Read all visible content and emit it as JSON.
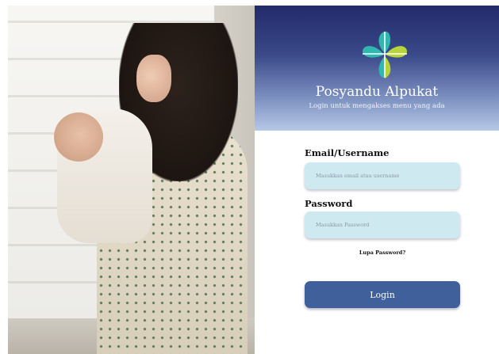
{
  "hero": {
    "image_alt": "Mother holding baby by window"
  },
  "app": {
    "title": "Posyandu Alpukat",
    "subtitle": "Login untuk mengakses menu yang ada",
    "logo_icon": "four-petal-flower-icon",
    "colors": {
      "header_top": "#222a6a",
      "header_bottom": "#b6c8e6",
      "input_bg": "#cfe9f0",
      "button_bg": "#40609b",
      "logo_teal": "#2fb8b0",
      "logo_green": "#b7d43a"
    }
  },
  "form": {
    "email": {
      "label": "Email/Username",
      "placeholder": "Masukkan email atau username",
      "value": ""
    },
    "password": {
      "label": "Password",
      "placeholder": "Masukkan Password",
      "value": ""
    },
    "forgot_label": "Lupa Password?",
    "login_label": "Login"
  }
}
